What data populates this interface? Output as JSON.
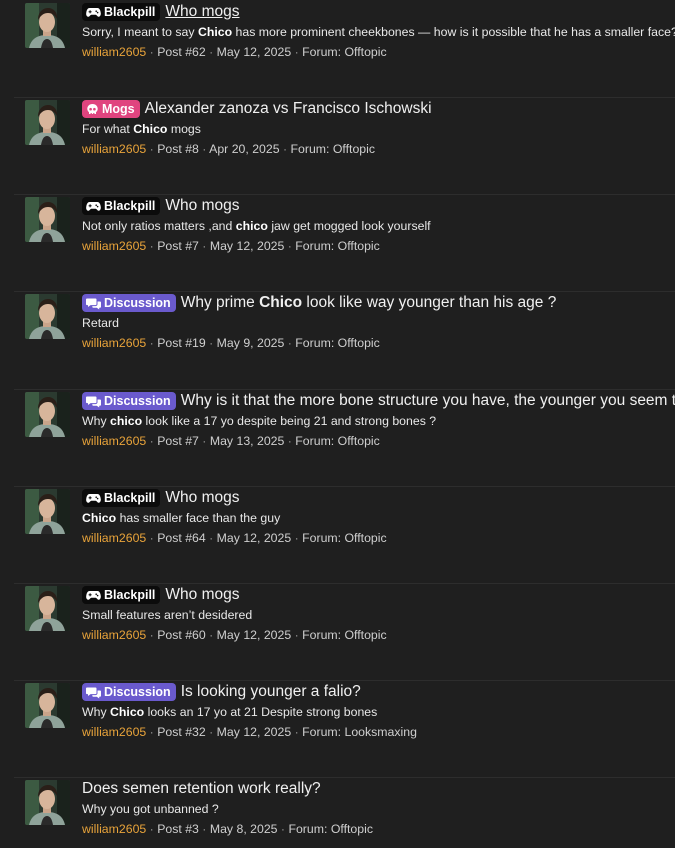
{
  "colors": {
    "background": "#1f1f1f",
    "username": "#e8a33a",
    "badge_blackpill": "#0b0b0b",
    "badge_mogs": "#e0447f",
    "badge_discussion": "#6a5acd"
  },
  "results": [
    {
      "badge": {
        "label": "Blackpill",
        "icon": "gamepad-icon",
        "type": "blackpill"
      },
      "title_parts": [
        {
          "t": "Who mogs",
          "b": false
        }
      ],
      "title_underlined": true,
      "snippet_parts": [
        {
          "t": "Sorry, I meant to say ",
          "b": false
        },
        {
          "t": "Chico",
          "b": true
        },
        {
          "t": " has more prominent cheekbones — how is it possible that he has a smaller face?",
          "b": false
        }
      ],
      "user": "william2605",
      "post": "Post #62",
      "date": "May 12, 2025",
      "forum": "Forum: Offtopic"
    },
    {
      "badge": {
        "label": "Mogs",
        "icon": "skull-icon",
        "type": "mogs"
      },
      "title_parts": [
        {
          "t": "Alexander zanoza vs Francisco Ischowski",
          "b": false
        }
      ],
      "title_underlined": false,
      "snippet_parts": [
        {
          "t": "For what ",
          "b": false
        },
        {
          "t": "Chico",
          "b": true
        },
        {
          "t": " mogs",
          "b": false
        }
      ],
      "user": "william2605",
      "post": "Post #8",
      "date": "Apr 20, 2025",
      "forum": "Forum: Offtopic"
    },
    {
      "badge": {
        "label": "Blackpill",
        "icon": "gamepad-icon",
        "type": "blackpill"
      },
      "title_parts": [
        {
          "t": "Who mogs",
          "b": false
        }
      ],
      "title_underlined": false,
      "snippet_parts": [
        {
          "t": "Not only ratios matters ,and ",
          "b": false
        },
        {
          "t": "chico",
          "b": true
        },
        {
          "t": " jaw get mogged look yourself",
          "b": false
        }
      ],
      "user": "william2605",
      "post": "Post #7",
      "date": "May 12, 2025",
      "forum": "Forum: Offtopic"
    },
    {
      "badge": {
        "label": "Discussion",
        "icon": "chat-bubbles-icon",
        "type": "discussion"
      },
      "title_parts": [
        {
          "t": "Why prime ",
          "b": false
        },
        {
          "t": "Chico",
          "b": true
        },
        {
          "t": " look like way younger than his age ?",
          "b": false
        }
      ],
      "title_underlined": false,
      "snippet_parts": [
        {
          "t": "Retard",
          "b": false
        }
      ],
      "user": "william2605",
      "post": "Post #19",
      "date": "May 9, 2025",
      "forum": "Forum: Offtopic"
    },
    {
      "badge": {
        "label": "Discussion",
        "icon": "chat-bubbles-icon",
        "type": "discussion"
      },
      "title_parts": [
        {
          "t": "Why is it that the more bone structure you have, the younger you seem to lo",
          "b": false
        }
      ],
      "title_underlined": false,
      "snippet_parts": [
        {
          "t": "Why ",
          "b": false
        },
        {
          "t": "chico",
          "b": true
        },
        {
          "t": " look like a 17 yo despite being 21 and strong bones ?",
          "b": false
        }
      ],
      "user": "william2605",
      "post": "Post #7",
      "date": "May 13, 2025",
      "forum": "Forum: Offtopic"
    },
    {
      "badge": {
        "label": "Blackpill",
        "icon": "gamepad-icon",
        "type": "blackpill"
      },
      "title_parts": [
        {
          "t": "Who mogs",
          "b": false
        }
      ],
      "title_underlined": false,
      "snippet_parts": [
        {
          "t": "Chico",
          "b": true
        },
        {
          "t": " has smaller face than the guy",
          "b": false
        }
      ],
      "user": "william2605",
      "post": "Post #64",
      "date": "May 12, 2025",
      "forum": "Forum: Offtopic"
    },
    {
      "badge": {
        "label": "Blackpill",
        "icon": "gamepad-icon",
        "type": "blackpill"
      },
      "title_parts": [
        {
          "t": "Who mogs",
          "b": false
        }
      ],
      "title_underlined": false,
      "snippet_parts": [
        {
          "t": "Small features aren’t desidered",
          "b": false
        }
      ],
      "user": "william2605",
      "post": "Post #60",
      "date": "May 12, 2025",
      "forum": "Forum: Offtopic"
    },
    {
      "badge": {
        "label": "Discussion",
        "icon": "chat-bubbles-icon",
        "type": "discussion"
      },
      "title_parts": [
        {
          "t": "Is looking younger a falio?",
          "b": false
        }
      ],
      "title_underlined": false,
      "snippet_parts": [
        {
          "t": "Why ",
          "b": false
        },
        {
          "t": "Chico",
          "b": true
        },
        {
          "t": " looks an 17 yo at 21 Despite strong bones",
          "b": false
        }
      ],
      "user": "william2605",
      "post": "Post #32",
      "date": "May 12, 2025",
      "forum": "Forum: Looksmaxing"
    },
    {
      "badge": null,
      "title_parts": [
        {
          "t": "Does semen retention work really?",
          "b": false
        }
      ],
      "title_underlined": false,
      "snippet_parts": [
        {
          "t": "Why you got unbanned ?",
          "b": false
        }
      ],
      "user": "william2605",
      "post": "Post #3",
      "date": "May 8, 2025",
      "forum": "Forum: Offtopic"
    }
  ]
}
